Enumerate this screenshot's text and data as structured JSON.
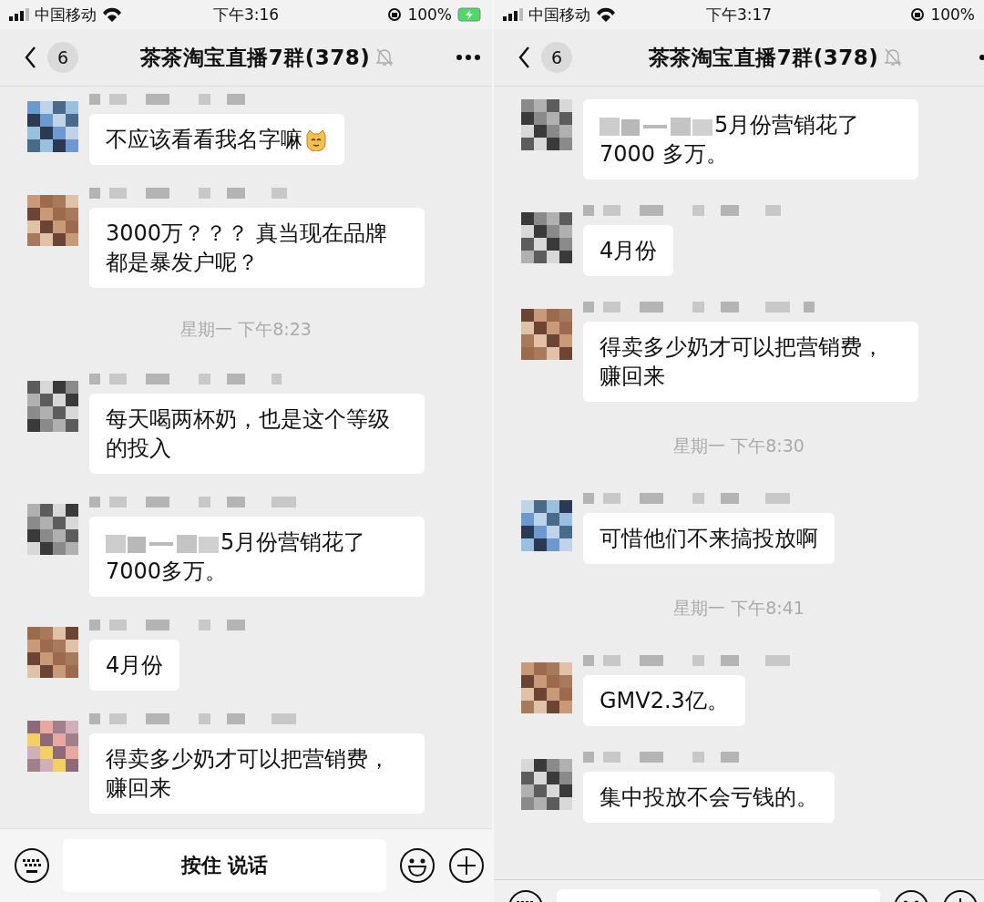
{
  "panels": [
    {
      "status_bar": {
        "carrier": "中国移动",
        "time": "下午3:16",
        "battery": "100%",
        "charging": true
      },
      "nav": {
        "back_badge": "6",
        "title": "茶茶淘宝直播7群(378)",
        "muted": true
      },
      "messages": [
        {
          "kind": "text",
          "name_shown": true,
          "blurred_prefix": false,
          "text": "不应该看看我名字嘛",
          "cat_emoji": true
        },
        {
          "kind": "text",
          "name_shown": true,
          "blurred_prefix": false,
          "text": "3000万？？？ 真当现在品牌都是暴发户呢？"
        },
        {
          "kind": "time",
          "text": "星期一 下午8:23"
        },
        {
          "kind": "text",
          "name_shown": true,
          "blurred_prefix": false,
          "text": "每天喝两杯奶，也是这个等级的投入"
        },
        {
          "kind": "text",
          "name_shown": true,
          "blurred_prefix": true,
          "text": "5月份营销花了7000多万。"
        },
        {
          "kind": "text",
          "name_shown": true,
          "blurred_prefix": false,
          "text": "4月份"
        },
        {
          "kind": "text",
          "name_shown": true,
          "blurred_prefix": false,
          "text": "得卖多少奶才可以把营销费，赚回来"
        }
      ],
      "input_bar": {
        "talk_button": "按住 说话"
      }
    },
    {
      "status_bar": {
        "carrier": "中国移动",
        "time": "下午3:17",
        "battery": "100%"
      },
      "nav": {
        "back_badge": "6",
        "title": "茶茶淘宝直播7群(378)",
        "muted": true
      },
      "messages": [
        {
          "kind": "text",
          "name_shown": false,
          "blurred_prefix": true,
          "text": "5月份营销花了 7000 多万。"
        },
        {
          "kind": "text",
          "name_shown": true,
          "blurred_prefix": false,
          "text": "4月份"
        },
        {
          "kind": "text",
          "name_shown": true,
          "blurred_prefix": false,
          "text": "得卖多少奶才可以把营销费，赚回来"
        },
        {
          "kind": "time",
          "text": "星期一 下午8:30"
        },
        {
          "kind": "text",
          "name_shown": true,
          "blurred_prefix": false,
          "text": "可惜他们不来搞投放啊"
        },
        {
          "kind": "time",
          "text": "星期一 下午8:41"
        },
        {
          "kind": "text",
          "name_shown": true,
          "blurred_prefix": false,
          "text": "GMV2.3亿。"
        },
        {
          "kind": "text",
          "name_shown": true,
          "blurred_prefix": false,
          "text": "集中投放不会亏钱的。"
        }
      ],
      "input_bar_partial": true
    }
  ]
}
